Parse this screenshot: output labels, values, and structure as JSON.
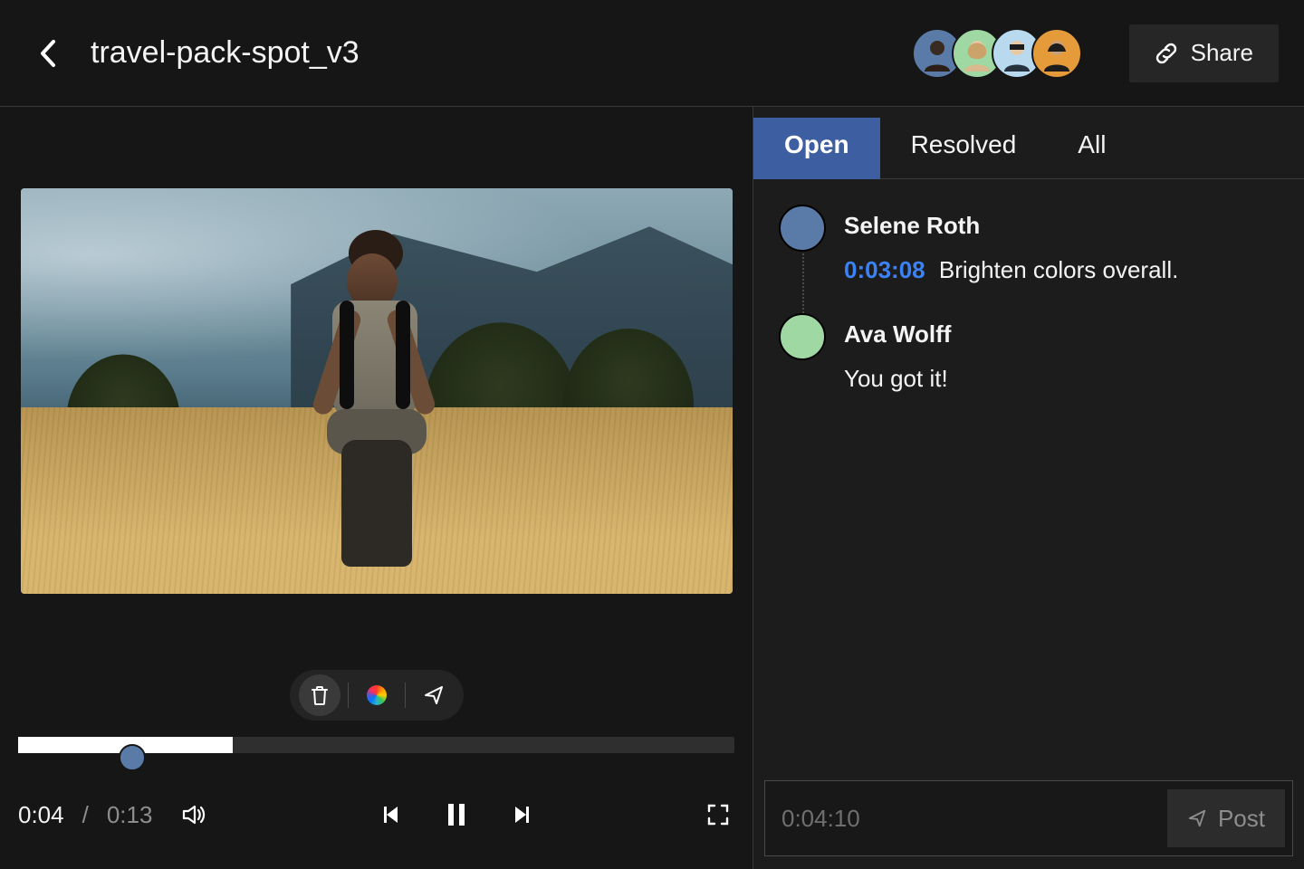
{
  "header": {
    "title": "travel-pack-spot_v3",
    "share_label": "Share",
    "collaborator_count": 4
  },
  "tools": {
    "delete_icon": "trash-icon",
    "color_icon": "color-wheel-icon",
    "send_icon": "paper-plane-icon"
  },
  "scrubber": {
    "progress_percent": 30,
    "marker_percent": 14
  },
  "transport": {
    "current": "0:04",
    "separator": "/",
    "duration": "0:13"
  },
  "tabs": [
    {
      "id": "open",
      "label": "Open",
      "active": true
    },
    {
      "id": "resolved",
      "label": "Resolved",
      "active": false
    },
    {
      "id": "all",
      "label": "All",
      "active": false
    }
  ],
  "comments": [
    {
      "author": "Selene Roth",
      "avatar_class": "u1",
      "timestamp": "0:03:08",
      "text": "Brighten colors overall."
    },
    {
      "author": "Ava Wolff",
      "avatar_class": "u2",
      "timestamp": "",
      "text": "You got it!"
    }
  ],
  "composer": {
    "timestamp": "0:04:10",
    "placeholder": "",
    "post_label": "Post"
  }
}
